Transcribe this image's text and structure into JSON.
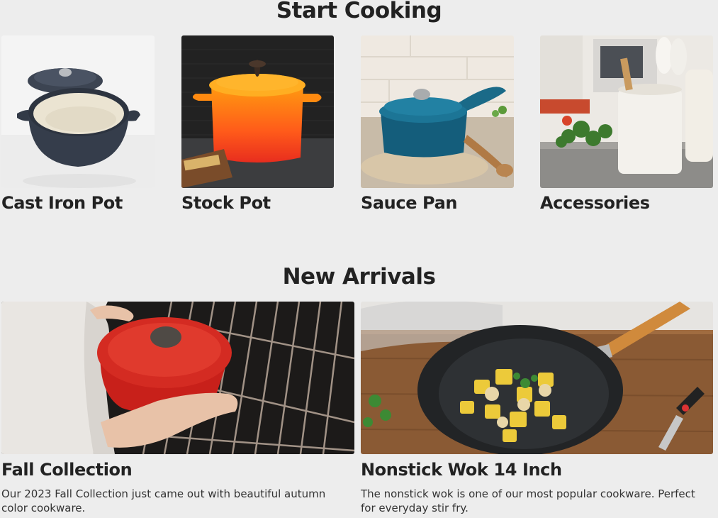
{
  "start_cooking": {
    "title": "Start Cooking",
    "items": [
      {
        "label": "Cast Iron Pot"
      },
      {
        "label": "Stock Pot"
      },
      {
        "label": "Sauce Pan"
      },
      {
        "label": "Accessories"
      }
    ]
  },
  "new_arrivals": {
    "title": "New Arrivals",
    "items": [
      {
        "label": "Fall Collection",
        "description": "Our 2023 Fall Collection just came out with beautiful autumn color cookware."
      },
      {
        "label": "Nonstick Wok 14 Inch",
        "description": "The nonstick wok is one of our most popular cookware. Perfect for everyday stir fry."
      }
    ]
  },
  "colors": {
    "background": "#ededed",
    "text": "#222222"
  }
}
